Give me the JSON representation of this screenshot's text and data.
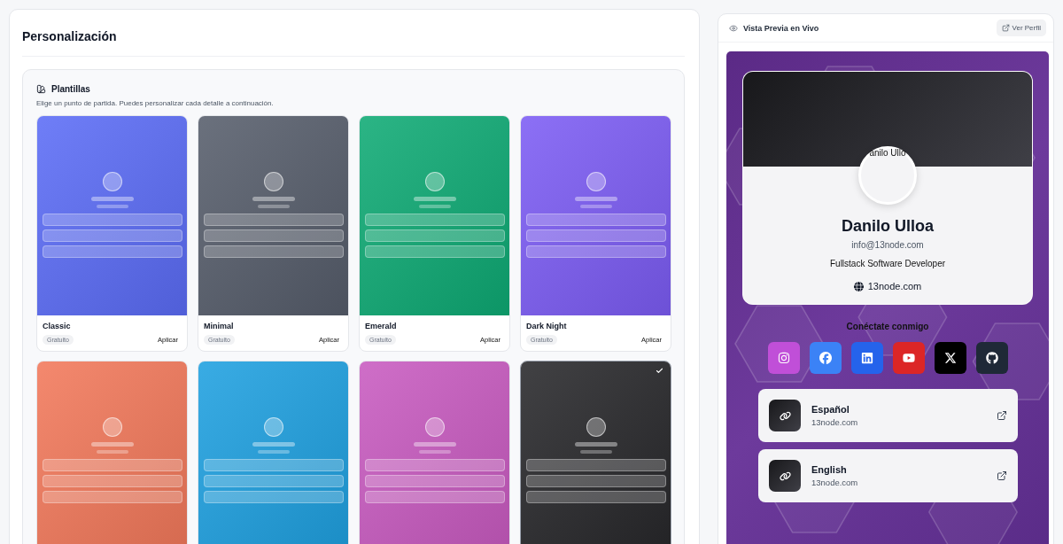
{
  "customization": {
    "title": "Personalización",
    "templates_section": {
      "title": "Plantillas",
      "description": "Elige un punto de partida. Puedes personalizar cada detalle a continuación.",
      "templates": [
        {
          "name": "Classic",
          "badge": "Gratuito",
          "action": "Aplicar",
          "color": "#5b6cf6",
          "selected": false
        },
        {
          "name": "Minimal",
          "badge": "Gratuito",
          "action": "Aplicar",
          "color": "#565d6b",
          "selected": false
        },
        {
          "name": "Emerald",
          "badge": "Gratuito",
          "action": "Aplicar",
          "color": "#0eaa74",
          "selected": false
        },
        {
          "name": "Dark Night",
          "badge": "Gratuito",
          "action": "Aplicar",
          "color": "#7c5cf4",
          "selected": false
        },
        {
          "color": "#f2785a",
          "selected": false
        },
        {
          "color": "#1ea0e0",
          "selected": false
        },
        {
          "color": "#c85ac0",
          "selected": false
        },
        {
          "color": "#27272a",
          "selected": true
        }
      ]
    }
  },
  "preview": {
    "title": "Vista Previa en Vivo",
    "view_button": "Ver Perfil",
    "profile": {
      "avatar_alt": "anilo Ullo",
      "name": "Danilo Ulloa",
      "email": "info@13node.com",
      "role": "Fullstack Software Developer",
      "website": "13node.com"
    },
    "social": {
      "title": "Conéctate conmigo",
      "links": [
        {
          "kind": "instagram",
          "color": "#c04fd8"
        },
        {
          "kind": "facebook",
          "color": "#3b82f6"
        },
        {
          "kind": "linkedin",
          "color": "#2563eb"
        },
        {
          "kind": "youtube",
          "color": "#dc2626"
        },
        {
          "kind": "x",
          "color": "#000000"
        },
        {
          "kind": "github",
          "color": "#1f2937"
        }
      ]
    },
    "links": [
      {
        "title": "Español",
        "url": "13node.com"
      },
      {
        "title": "English",
        "url": "13node.com"
      }
    ]
  }
}
